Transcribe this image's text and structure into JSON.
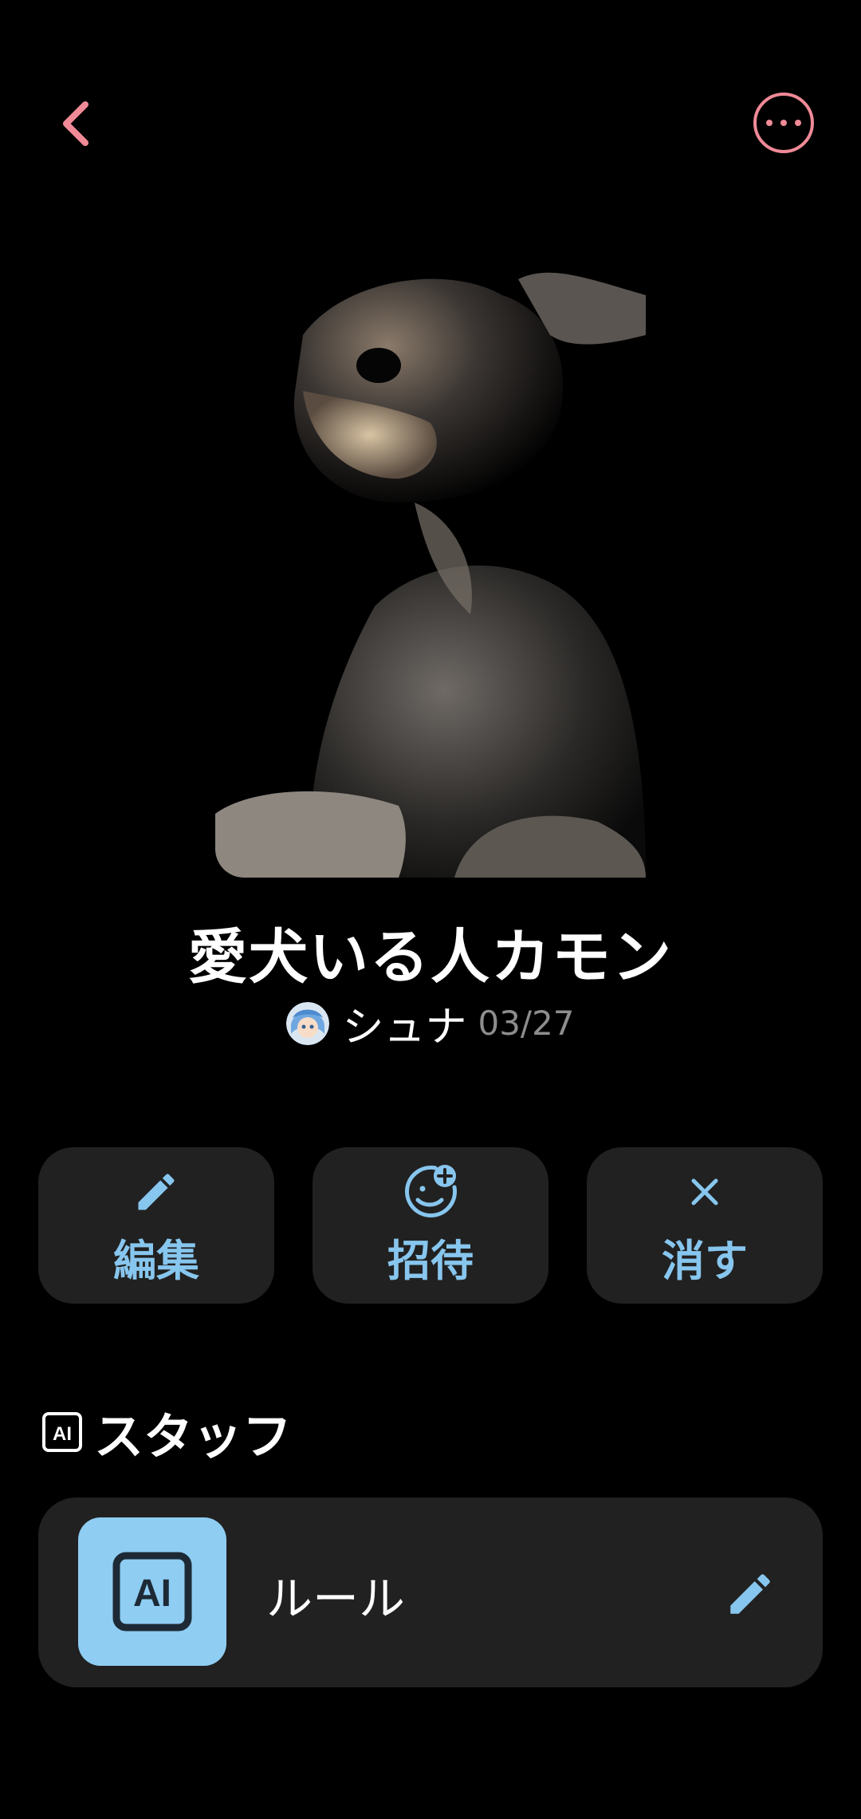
{
  "post": {
    "title": "愛犬いる人カモン",
    "author": "シュナ",
    "date": "03/27"
  },
  "actions": [
    {
      "label": "編集",
      "icon": "pencil-icon"
    },
    {
      "label": "招待",
      "icon": "invite-icon"
    },
    {
      "label": "消す",
      "icon": "close-icon"
    }
  ],
  "staff_section": {
    "badge": "AI",
    "title": "スタッフ",
    "items": [
      {
        "badge": "AI",
        "name": "ルール",
        "edit_icon": "pencil-icon"
      }
    ]
  },
  "colors": {
    "accent_pink": "#f08a97",
    "accent_blue": "#87c6ee",
    "card_bg": "#212121",
    "ai_tile_bg": "#8fcdf3"
  }
}
